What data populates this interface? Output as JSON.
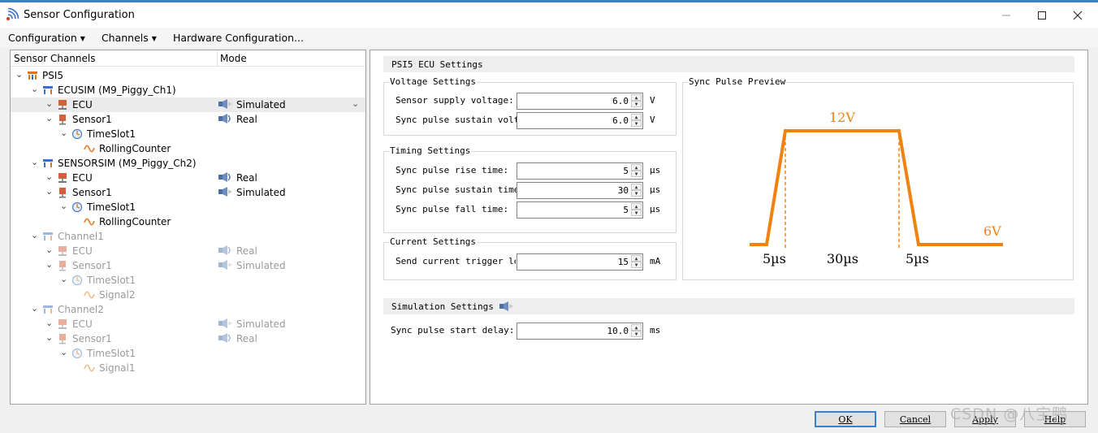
{
  "window": {
    "title": "Sensor Configuration"
  },
  "menu": [
    "Configuration",
    "Channels",
    "Hardware Configuration..."
  ],
  "tree": {
    "col_name": "Sensor Channels",
    "col_mode": "Mode",
    "rows": [
      {
        "label": "PSI5",
        "mode": "",
        "level": 0,
        "icon": "psi5-icon"
      },
      {
        "label": "ECUSIM (M9_Piggy_Ch1)",
        "mode": "",
        "level": 1,
        "icon": "channel-icon"
      },
      {
        "label": "ECU",
        "mode": "Simulated",
        "level": 2,
        "icon": "ecu-icon"
      },
      {
        "label": "Sensor1",
        "mode": "Real",
        "level": 2,
        "icon": "sensor-icon"
      },
      {
        "label": "TimeSlot1",
        "mode": "",
        "level": 3,
        "icon": "timeslot-icon"
      },
      {
        "label": "RollingCounter",
        "mode": "",
        "level": 4,
        "icon": "signal-icon"
      },
      {
        "label": "SENSORSIM (M9_Piggy_Ch2)",
        "mode": "",
        "level": 1,
        "icon": "channel-icon"
      },
      {
        "label": "ECU",
        "mode": "Real",
        "level": 2,
        "icon": "ecu-icon"
      },
      {
        "label": "Sensor1",
        "mode": "Simulated",
        "level": 2,
        "icon": "sensor-icon"
      },
      {
        "label": "TimeSlot1",
        "mode": "",
        "level": 3,
        "icon": "timeslot-icon"
      },
      {
        "label": "RollingCounter",
        "mode": "",
        "level": 4,
        "icon": "signal-icon"
      },
      {
        "label": "Channel1",
        "mode": "",
        "level": 1,
        "icon": "channel-icon"
      },
      {
        "label": "ECU",
        "mode": "Real",
        "level": 2,
        "icon": "ecu-icon"
      },
      {
        "label": "Sensor1",
        "mode": "Simulated",
        "level": 2,
        "icon": "sensor-icon"
      },
      {
        "label": "TimeSlot1",
        "mode": "",
        "level": 3,
        "icon": "timeslot-icon"
      },
      {
        "label": "Signal2",
        "mode": "",
        "level": 4,
        "icon": "signal-icon"
      },
      {
        "label": "Channel2",
        "mode": "",
        "level": 1,
        "icon": "channel-icon"
      },
      {
        "label": "ECU",
        "mode": "Simulated",
        "level": 2,
        "icon": "ecu-icon"
      },
      {
        "label": "Sensor1",
        "mode": "Real",
        "level": 2,
        "icon": "sensor-icon"
      },
      {
        "label": "TimeSlot1",
        "mode": "",
        "level": 3,
        "icon": "timeslot-icon"
      },
      {
        "label": "Signal1",
        "mode": "",
        "level": 4,
        "icon": "signal-icon"
      }
    ]
  },
  "settings": {
    "title": "PSI5 ECU Settings",
    "voltage": {
      "title": "Voltage Settings",
      "supply_label": "Sensor supply voltage:",
      "supply_value": "6.0",
      "supply_unit": "V",
      "sustain_label": "Sync pulse sustain voltage:",
      "sustain_value": "6.0",
      "sustain_unit": "V"
    },
    "timing": {
      "title": "Timing Settings",
      "rise_label": "Sync pulse rise time:",
      "rise_value": "5",
      "rise_unit": "µs",
      "sustain_label": "Sync pulse sustain time:",
      "sustain_value": "30",
      "sustain_unit": "µs",
      "fall_label": "Sync pulse fall time:",
      "fall_value": "5",
      "fall_unit": "µs"
    },
    "current": {
      "title": "Current Settings",
      "trigger_label": "Send current trigger leve",
      "trigger_value": "15",
      "trigger_unit": "mA"
    },
    "preview": {
      "title": "Sync Pulse Preview",
      "high_label": "12V",
      "low_label": "6V",
      "rise_label": "5µs",
      "sustain_label": "30µs",
      "fall_label": "5µs",
      "color": "#f0820f"
    },
    "simulation": {
      "title": "Simulation Settings",
      "delay_label": "Sync pulse start delay:",
      "delay_value": "10.0",
      "delay_unit": "ms"
    }
  },
  "buttons": {
    "ok": "OK",
    "cancel": "Cancel",
    "apply": "Apply",
    "help": "Help"
  },
  "watermark": "CSDN @八宝鸭"
}
